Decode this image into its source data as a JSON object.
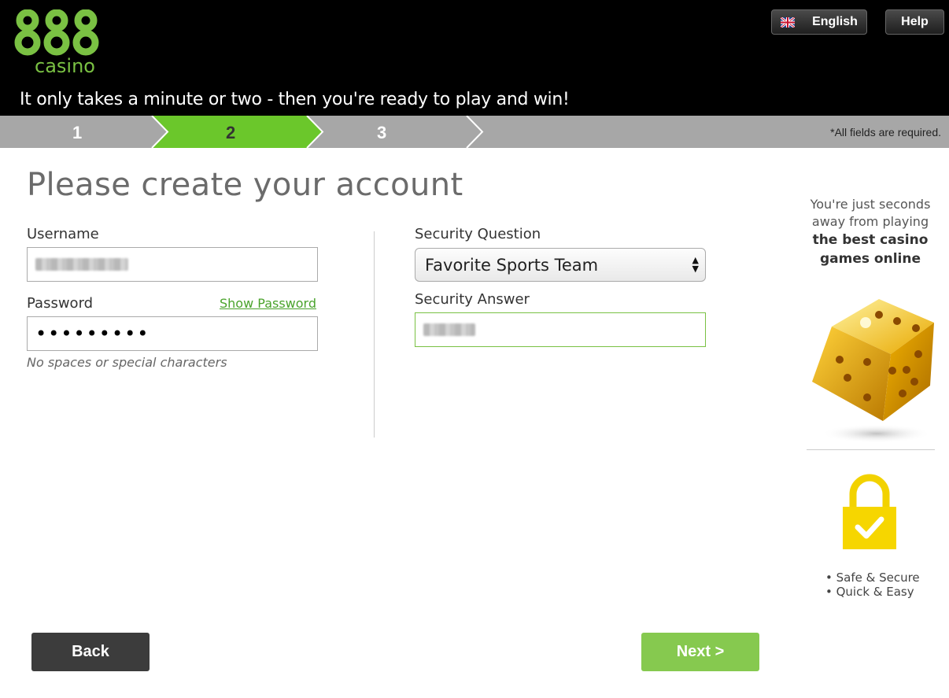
{
  "header": {
    "logo_number": "888",
    "logo_text": "casino",
    "tagline": "It only takes a minute or two - then you're ready to play and win!",
    "language_label": "English",
    "help_label": "Help"
  },
  "steps": {
    "items": [
      "1",
      "2",
      "3"
    ],
    "active_step": 2,
    "required_note": "*All fields are required."
  },
  "form": {
    "title": "Please create your account",
    "username_label": "Username",
    "password_label": "Password",
    "password_dots": "•••••••••",
    "show_password_label": "Show Password",
    "password_hint": "No spaces or special characters",
    "security_question_label": "Security Question",
    "security_question_value": "Favorite Sports Team",
    "security_answer_label": "Security Answer"
  },
  "sidebar": {
    "promo_line1": "You're just seconds away from playing",
    "promo_bold": "the best casino games online",
    "features": [
      "• Safe & Secure",
      "• Quick & Easy"
    ]
  },
  "buttons": {
    "back_label": "Back",
    "next_label": "Next >"
  },
  "colors": {
    "brand_green": "#7ac143",
    "active_step": "#6bc72b",
    "next_button": "#86c94f",
    "back_button": "#3c3c3c"
  }
}
